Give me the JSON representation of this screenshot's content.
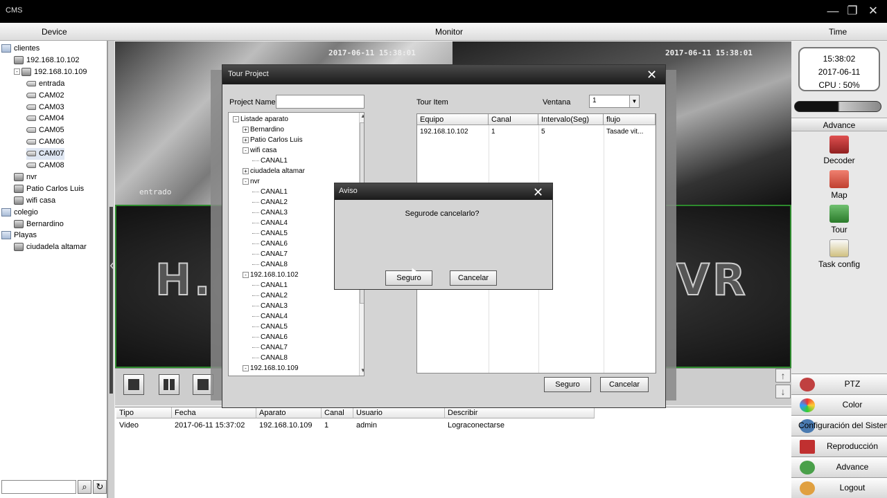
{
  "window": {
    "title": "CMS",
    "controls": [
      "—",
      "❐",
      "✕"
    ]
  },
  "header": {
    "device": "Device",
    "monitor": "Monitor",
    "time": "Time"
  },
  "device_tree": [
    {
      "label": "clientes",
      "icon": "folder-icon",
      "toggle": ""
    },
    {
      "label": "192.168.10.102",
      "icon": "dvr-icon",
      "toggle": ""
    },
    {
      "label": "192.168.10.109",
      "icon": "dvr-icon",
      "toggle": "-"
    },
    {
      "label": "entrada",
      "icon": "camera-icon",
      "toggle": ""
    },
    {
      "label": "CAM02",
      "icon": "camera-icon",
      "toggle": ""
    },
    {
      "label": "CAM03",
      "icon": "camera-icon",
      "toggle": ""
    },
    {
      "label": "CAM04",
      "icon": "camera-icon",
      "toggle": ""
    },
    {
      "label": "CAM05",
      "icon": "camera-icon",
      "toggle": ""
    },
    {
      "label": "CAM06",
      "icon": "camera-icon",
      "toggle": ""
    },
    {
      "label": "CAM07",
      "icon": "camera-icon",
      "toggle": ""
    },
    {
      "label": "CAM08",
      "icon": "camera-icon",
      "toggle": ""
    },
    {
      "label": "nvr",
      "icon": "dvr-icon",
      "toggle": ""
    },
    {
      "label": "Patio Carlos Luis",
      "icon": "dvr-icon",
      "toggle": ""
    },
    {
      "label": "wifi casa",
      "icon": "dvr-icon",
      "toggle": ""
    },
    {
      "label": "colegio",
      "icon": "folder-icon",
      "toggle": ""
    },
    {
      "label": "Bernardino",
      "icon": "dvr-icon",
      "toggle": ""
    },
    {
      "label": "Playas",
      "icon": "folder-icon",
      "toggle": ""
    },
    {
      "label": "ciudadela altamar",
      "icon": "dvr-icon",
      "toggle": ""
    }
  ],
  "video": {
    "timestamp_1": "2017-06-11 15:38:01",
    "timestamp_2": "2017-06-11 15:38:01",
    "cam_label": "entrado",
    "logo_left": "H.",
    "logo_right": "VR"
  },
  "log": {
    "headers": [
      "Tipo",
      "Fecha",
      "Aparato",
      "Canal",
      "Usuario",
      "Describir"
    ],
    "rows": [
      [
        "Video",
        "2017-06-11 15:37:02",
        "192.168.10.109",
        "1",
        "admin",
        "Lograconectarse"
      ]
    ]
  },
  "right_panel": {
    "time": "15:38:02",
    "date": "2017-06-11",
    "cpu": "CPU : 50%",
    "cpu_usage": 0.5,
    "advance_header": "Advance",
    "tools": [
      "Decoder",
      "Map",
      "Tour",
      "Task config"
    ],
    "buttons": [
      "PTZ",
      "Color",
      "Configuración del Sistema",
      "Reproducción",
      "Advance",
      "Logout"
    ]
  },
  "tour_dialog": {
    "title": "Tour Project",
    "project_name_label": "Project Name",
    "project_name_value": "",
    "tour_item_label": "Tour Item",
    "ventana_label": "Ventana",
    "ventana_value": "1",
    "tree": [
      {
        "label": "Listade aparato",
        "toggle": "-"
      },
      {
        "label": "Bernardino",
        "toggle": "+"
      },
      {
        "label": "Patio Carlos Luis",
        "toggle": "+"
      },
      {
        "label": "wifi casa",
        "toggle": "-"
      },
      {
        "label": "CANAL1",
        "toggle": ""
      },
      {
        "label": "ciudadela altamar",
        "toggle": "+"
      },
      {
        "label": "nvr",
        "toggle": "-"
      },
      {
        "label": "CANAL1",
        "toggle": ""
      },
      {
        "label": "CANAL2",
        "toggle": ""
      },
      {
        "label": "CANAL3",
        "toggle": ""
      },
      {
        "label": "CANAL4",
        "toggle": ""
      },
      {
        "label": "CANAL5",
        "toggle": ""
      },
      {
        "label": "CANAL6",
        "toggle": ""
      },
      {
        "label": "CANAL7",
        "toggle": ""
      },
      {
        "label": "CANAL8",
        "toggle": ""
      },
      {
        "label": "192.168.10.102",
        "toggle": "-"
      },
      {
        "label": "CANAL1",
        "toggle": ""
      },
      {
        "label": "CANAL2",
        "toggle": ""
      },
      {
        "label": "CANAL3",
        "toggle": ""
      },
      {
        "label": "CANAL4",
        "toggle": ""
      },
      {
        "label": "CANAL5",
        "toggle": ""
      },
      {
        "label": "CANAL6",
        "toggle": ""
      },
      {
        "label": "CANAL7",
        "toggle": ""
      },
      {
        "label": "CANAL8",
        "toggle": ""
      },
      {
        "label": "192.168.10.109",
        "toggle": "-"
      }
    ],
    "grid_headers": [
      "Equipo",
      "Canal",
      "Intervalo(Seg)",
      "flujo"
    ],
    "grid_rows": [
      [
        "192.168.10.102",
        "1",
        "5",
        "Tasade vit..."
      ]
    ],
    "ok_label": "Seguro",
    "cancel_label": "Cancelar"
  },
  "aviso_dialog": {
    "title": "Aviso",
    "message": "Segurode cancelarlo?",
    "ok_label": "Seguro",
    "cancel_label": "Cancelar"
  }
}
